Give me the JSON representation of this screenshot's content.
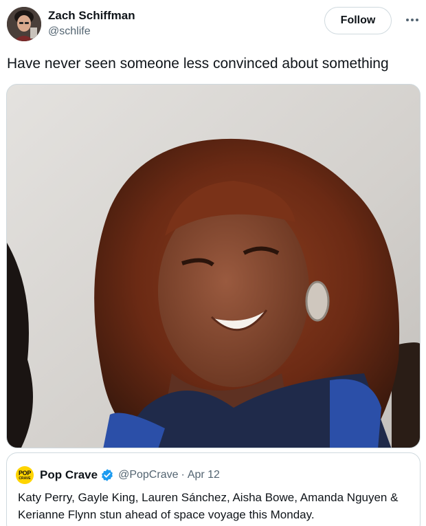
{
  "author": {
    "display_name": "Zach Schiffman",
    "handle": "@schlife",
    "avatar_icon": "user-avatar"
  },
  "actions": {
    "follow_label": "Follow",
    "more_icon": "more-horizontal-icon"
  },
  "tweet": {
    "text": "Have never seen someone less convinced about something"
  },
  "media": {
    "kind": "photo",
    "subject": "woman-smiling-portrait"
  },
  "quote": {
    "logo_line1": "POP",
    "logo_line2": "CRAVE",
    "display_name": "Pop Crave",
    "verified": true,
    "handle": "@PopCrave",
    "separator": "·",
    "date": "Apr 12",
    "text": "Katy Perry, Gayle King, Lauren Sánchez, Aisha Bowe, Amanda Nguyen & Kerianne Flynn stun ahead of space voyage this Monday.",
    "accent_color": "#ffd400",
    "verified_color": "#1d9bf0"
  },
  "colors": {
    "text_primary": "#0f1419",
    "text_secondary": "#536471",
    "border": "#cfd9de"
  }
}
